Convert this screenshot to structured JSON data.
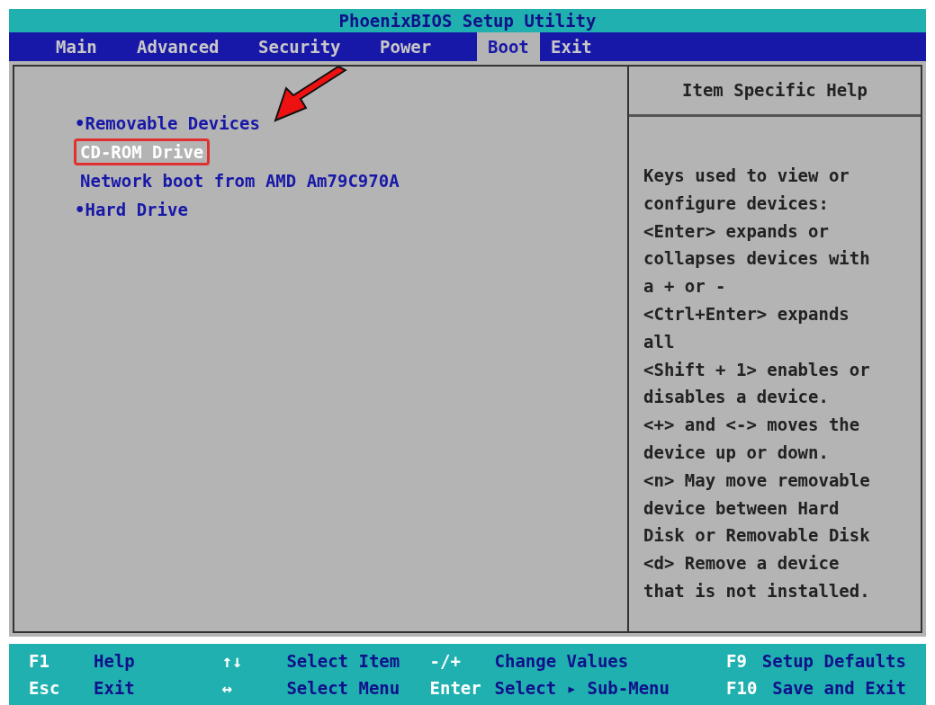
{
  "window": {
    "title": "PhoenixBIOS Setup Utility"
  },
  "tabs": [
    {
      "label": "Main",
      "selected": false
    },
    {
      "label": "Advanced",
      "selected": false
    },
    {
      "label": "Security",
      "selected": false
    },
    {
      "label": "Power",
      "selected": false
    },
    {
      "label": "Boot",
      "selected": true
    },
    {
      "label": "Exit",
      "selected": false
    }
  ],
  "boot_items": [
    {
      "label": "•Removable Devices",
      "kind": "group",
      "selected": false
    },
    {
      "label": "CD-ROM Drive",
      "kind": "device",
      "selected": true
    },
    {
      "label": "Network boot from AMD Am79C970A",
      "kind": "device",
      "selected": false
    },
    {
      "label": "•Hard Drive",
      "kind": "group",
      "selected": false
    }
  ],
  "help": {
    "title": "Item Specific Help",
    "lines": [
      "Keys used to view or",
      "configure devices:",
      "<Enter> expands or",
      "collapses devices with",
      "a + or -",
      "<Ctrl+Enter> expands",
      "all",
      "<Shift + 1> enables or",
      "disables a device.",
      "<+> and <-> moves the",
      "device up or down.",
      "<n> May move removable",
      "device between Hard",
      "Disk or Removable Disk",
      "<d> Remove a device",
      "that is not installed."
    ]
  },
  "footer": [
    [
      {
        "key": "F1",
        "label": "Help"
      },
      {
        "key": "↑↓",
        "label": "Select Item"
      },
      {
        "key": "-/+",
        "label": "Change Values"
      },
      {
        "key": "F9",
        "label": "Setup Defaults"
      }
    ],
    [
      {
        "key": "Esc",
        "label": "Exit"
      },
      {
        "key": "↔",
        "label": "Select Menu"
      },
      {
        "key": "Enter",
        "label": "Select ▸ Sub-Menu"
      },
      {
        "key": "F10",
        "label": "Save and Exit"
      }
    ]
  ]
}
